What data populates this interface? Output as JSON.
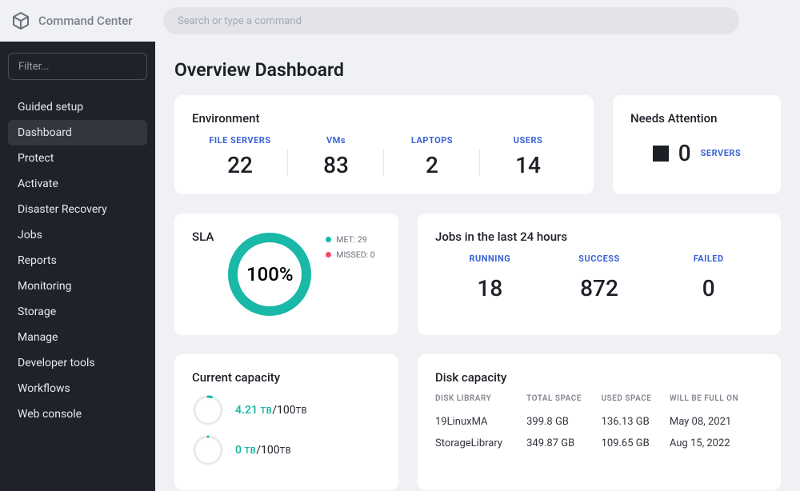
{
  "header": {
    "app_name": "Command Center",
    "search_placeholder": "Search or type a command"
  },
  "sidebar": {
    "filter_placeholder": "Filter...",
    "items": [
      {
        "label": "Guided setup"
      },
      {
        "label": "Dashboard",
        "active": true
      },
      {
        "label": "Protect"
      },
      {
        "label": "Activate"
      },
      {
        "label": "Disaster Recovery"
      },
      {
        "label": "Jobs"
      },
      {
        "label": "Reports"
      },
      {
        "label": "Monitoring"
      },
      {
        "label": "Storage"
      },
      {
        "label": "Manage"
      },
      {
        "label": "Developer tools"
      },
      {
        "label": "Workflows"
      },
      {
        "label": "Web console"
      }
    ]
  },
  "page": {
    "title": "Overview Dashboard"
  },
  "environment": {
    "title": "Environment",
    "items": [
      {
        "label": "FILE SERVERS",
        "value": "22"
      },
      {
        "label": "VMs",
        "value": "83"
      },
      {
        "label": "LAPTOPS",
        "value": "2"
      },
      {
        "label": "USERS",
        "value": "14"
      }
    ]
  },
  "needs_attention": {
    "title": "Needs Attention",
    "count": "0",
    "label": "SERVERS"
  },
  "sla": {
    "title": "SLA",
    "percent": "100%",
    "legend_met_label": "MET: 29",
    "legend_missed_label": "MISSED: 0",
    "chart_data": {
      "type": "pie",
      "title": "SLA",
      "series": [
        {
          "name": "MET",
          "value": 29,
          "color": "#19b8a7"
        },
        {
          "name": "MISSED",
          "value": 0,
          "color": "#ef4b6c"
        }
      ]
    }
  },
  "jobs": {
    "title": "Jobs in the last 24 hours",
    "items": [
      {
        "label": "RUNNING",
        "value": "18"
      },
      {
        "label": "SUCCESS",
        "value": "872"
      },
      {
        "label": "FAILED",
        "value": "0"
      }
    ]
  },
  "current_capacity": {
    "title": "Current capacity",
    "rows": [
      {
        "used": "4.21",
        "used_unit": "TB",
        "total": "100",
        "total_unit": "TB",
        "pct": 4.21
      },
      {
        "used": "0",
        "used_unit": "TB",
        "total": "100",
        "total_unit": "TB",
        "pct": 0
      }
    ]
  },
  "disk_capacity": {
    "title": "Disk capacity",
    "columns": [
      "DISK LIBRARY",
      "TOTAL SPACE",
      "USED SPACE",
      "WILL BE FULL ON"
    ],
    "rows": [
      {
        "library": "19LinuxMA",
        "total": "399.8 GB",
        "used": "136.13 GB",
        "full_on": "May 08, 2021"
      },
      {
        "library": "StorageLibrary",
        "total": "349.87 GB",
        "used": "109.65 GB",
        "full_on": "Aug 15, 2022"
      }
    ]
  }
}
